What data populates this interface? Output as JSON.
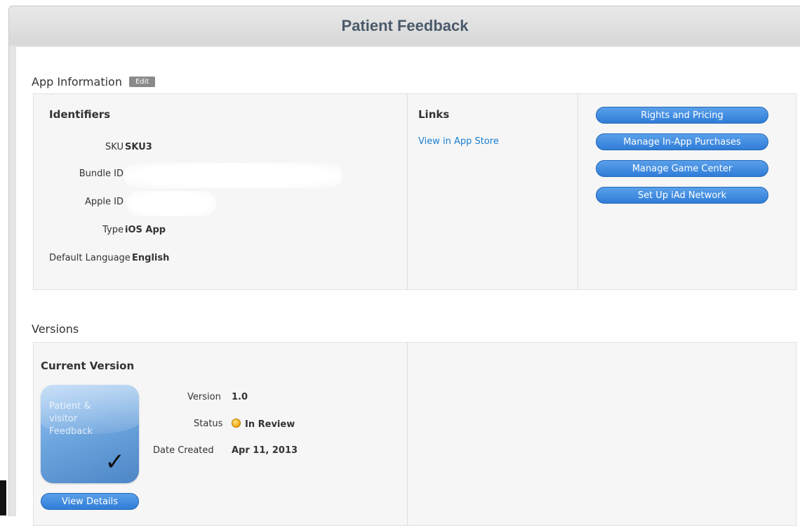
{
  "window": {
    "title": "Patient Feedback"
  },
  "app_information": {
    "heading": "App Information",
    "edit_label": "Edit",
    "identifiers": {
      "heading": "Identifiers",
      "rows": [
        {
          "label": "SKU",
          "value": "SKU3"
        },
        {
          "label": "Bundle ID",
          "value": ""
        },
        {
          "label": "Apple ID",
          "value": ""
        },
        {
          "label": "Type",
          "value": "iOS App"
        },
        {
          "label": "Default Language",
          "value": "English"
        }
      ]
    },
    "links": {
      "heading": "Links",
      "view_in_store": "View in App Store"
    },
    "actions": [
      "Rights and Pricing",
      "Manage In-App Purchases",
      "Manage Game Center",
      "Set Up iAd Network"
    ]
  },
  "versions": {
    "heading": "Versions",
    "current": {
      "heading": "Current Version",
      "icon_text": [
        "Patient &",
        "visitor",
        "Feedback"
      ],
      "version_label": "Version",
      "version_value": "1.0",
      "status_label": "Status",
      "status_value": "In Review",
      "date_label": "Date Created",
      "date_value": "Apr 11, 2013",
      "view_details_label": "View Details"
    }
  },
  "colors": {
    "accent": "#2f7dd8",
    "link": "#1a7fd0",
    "status_in_review": "#f0a810"
  },
  "icons": {
    "status": "status-dot-icon",
    "checkmark": "checkmark-icon"
  }
}
